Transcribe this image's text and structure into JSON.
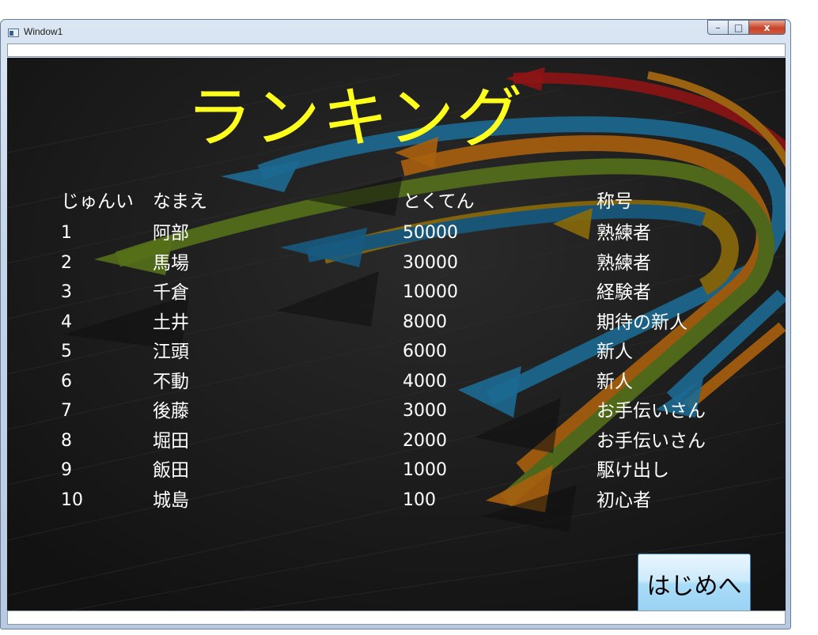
{
  "window": {
    "title": "Window1",
    "controls": {
      "minimize": "–",
      "maximize": "□",
      "close": "x"
    }
  },
  "screen": {
    "title": "ランキング",
    "headers": {
      "rank": "じゅんい",
      "name": "なまえ",
      "score": "とくてん",
      "rank_title": "称号"
    },
    "rows": [
      {
        "rank": "1",
        "name": "阿部",
        "score": "50000",
        "title": "熟練者"
      },
      {
        "rank": "2",
        "name": "馬場",
        "score": "30000",
        "title": "熟練者"
      },
      {
        "rank": "3",
        "name": "千倉",
        "score": "10000",
        "title": "経験者"
      },
      {
        "rank": "4",
        "name": "土井",
        "score": "8000",
        "title": "期待の新人"
      },
      {
        "rank": "5",
        "name": "江頭",
        "score": "6000",
        "title": "新人"
      },
      {
        "rank": "6",
        "name": "不動",
        "score": "4000",
        "title": "新人"
      },
      {
        "rank": "7",
        "name": "後藤",
        "score": "3000",
        "title": "お手伝いさん"
      },
      {
        "rank": "8",
        "name": "堀田",
        "score": "2000",
        "title": "お手伝いさん"
      },
      {
        "rank": "9",
        "name": "飯田",
        "score": "1000",
        "title": "駆け出し"
      },
      {
        "rank": "10",
        "name": "城島",
        "score": "100",
        "title": "初心者"
      }
    ],
    "start_button": "はじめへ"
  },
  "colors": {
    "title": "#ffff1e",
    "text": "#ffffff",
    "background": "#1b1b1b",
    "button": "#a9dcf8"
  }
}
